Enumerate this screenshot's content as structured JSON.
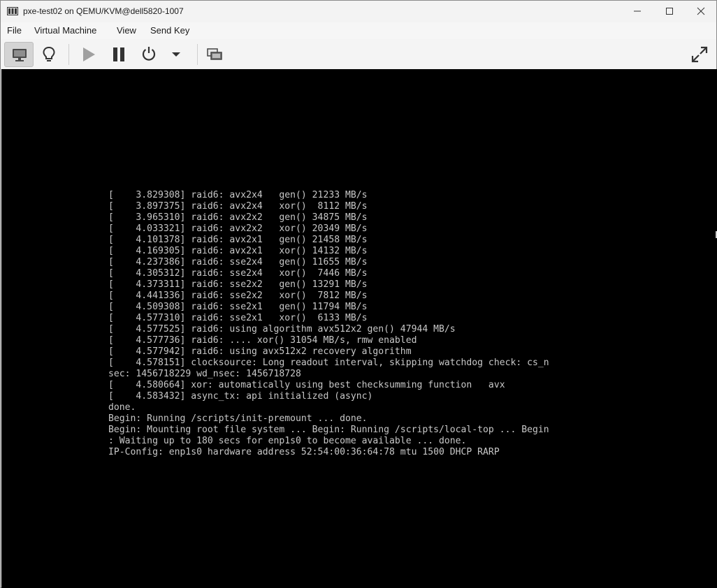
{
  "window": {
    "title": "pxe-test02 on QEMU/KVM@dell5820-1007"
  },
  "menubar": {
    "items": [
      "File",
      "Virtual Machine",
      "View",
      "Send Key"
    ]
  },
  "toolbar": {
    "buttons": [
      {
        "name": "console-view",
        "icon": "monitor-icon",
        "active": true
      },
      {
        "name": "details-view",
        "icon": "lightbulb-icon"
      },
      {
        "name": "run",
        "icon": "play-icon"
      },
      {
        "name": "pause",
        "icon": "pause-icon"
      },
      {
        "name": "shutdown",
        "icon": "power-icon"
      },
      {
        "name": "shutdown-menu",
        "icon": "chevron-down-icon"
      },
      {
        "name": "snapshots",
        "icon": "snapshot-icon"
      },
      {
        "name": "fullscreen",
        "icon": "fullscreen-icon"
      }
    ]
  },
  "console": {
    "lines": [
      "[    3.829308] raid6: avx2x4   gen() 21233 MB/s",
      "[    3.897375] raid6: avx2x4   xor()  8112 MB/s",
      "[    3.965310] raid6: avx2x2   gen() 34875 MB/s",
      "[    4.033321] raid6: avx2x2   xor() 20349 MB/s",
      "[    4.101378] raid6: avx2x1   gen() 21458 MB/s",
      "[    4.169305] raid6: avx2x1   xor() 14132 MB/s",
      "[    4.237386] raid6: sse2x4   gen() 11655 MB/s",
      "[    4.305312] raid6: sse2x4   xor()  7446 MB/s",
      "[    4.373311] raid6: sse2x2   gen() 13291 MB/s",
      "[    4.441336] raid6: sse2x2   xor()  7812 MB/s",
      "[    4.509308] raid6: sse2x1   gen() 11794 MB/s",
      "[    4.577310] raid6: sse2x1   xor()  6133 MB/s",
      "[    4.577525] raid6: using algorithm avx512x2 gen() 47944 MB/s",
      "[    4.577736] raid6: .... xor() 31054 MB/s, rmw enabled",
      "[    4.577942] raid6: using avx512x2 recovery algorithm",
      "[    4.578151] clocksource: Long readout interval, skipping watchdog check: cs_n",
      "sec: 1456718229 wd_nsec: 1456718728",
      "[    4.580664] xor: automatically using best checksumming function   avx",
      "[    4.583432] async_tx: api initialized (async)",
      "done.",
      "Begin: Running /scripts/init-premount ... done.",
      "Begin: Mounting root file system ... Begin: Running /scripts/local-top ... Begin",
      ": Waiting up to 180 secs for enp1s0 to become available ... done.",
      "IP-Config: enp1s0 hardware address 52:54:00:36:64:78 mtu 1500 DHCP RARP"
    ]
  }
}
